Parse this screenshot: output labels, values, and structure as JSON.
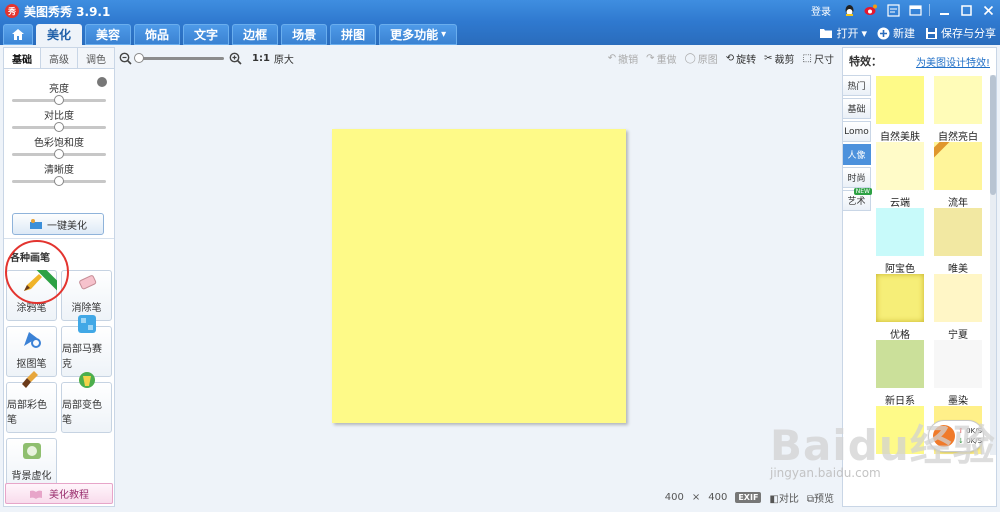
{
  "app": {
    "title": "美图秀秀 3.9.1",
    "logo_text": "秀"
  },
  "titlebar": {
    "login": "登录"
  },
  "nav": {
    "tabs": [
      {
        "label": "美化",
        "active": true
      },
      {
        "label": "美容"
      },
      {
        "label": "饰品"
      },
      {
        "label": "文字"
      },
      {
        "label": "边框"
      },
      {
        "label": "场景"
      },
      {
        "label": "拼图"
      },
      {
        "label": "更多功能"
      }
    ],
    "open": "打开",
    "new": "新建",
    "save_share": "保存与分享"
  },
  "left": {
    "subtabs": [
      "基础",
      "高级",
      "调色"
    ],
    "sliders": [
      {
        "label": "亮度",
        "value": 0.5
      },
      {
        "label": "对比度",
        "value": 0.5
      },
      {
        "label": "色彩饱和度",
        "value": 0.5
      },
      {
        "label": "清晰度",
        "value": 0.5
      }
    ],
    "one_key": "一键美化",
    "brushes_title": "各种画笔",
    "brushes": [
      {
        "label": "涂鸦笔"
      },
      {
        "label": "消除笔"
      },
      {
        "label": "抠图笔"
      },
      {
        "label": "局部马赛克"
      },
      {
        "label": "局部彩色笔"
      },
      {
        "label": "局部变色笔"
      },
      {
        "label": "背景虚化"
      }
    ],
    "tutorial": "美化教程"
  },
  "toolbar": {
    "ratio": "1:1",
    "original": "原大",
    "undo": "撤销",
    "redo": "重做",
    "orig_pic": "原图",
    "rotate": "旋转",
    "crop": "裁剪",
    "size": "尺寸"
  },
  "canvas": {
    "color": "#fefa88"
  },
  "status": {
    "width": "400",
    "times": "×",
    "height": "400",
    "exif": "EXIF",
    "compare": "对比",
    "preview": "预览"
  },
  "right": {
    "title": "特效：",
    "link": "为美图设计特效!",
    "categories": [
      {
        "label": "热门"
      },
      {
        "label": "基础"
      },
      {
        "label": "Lomo"
      },
      {
        "label": "人像",
        "active": true
      },
      {
        "label": "时尚"
      },
      {
        "label": "艺术",
        "badge": "NEW"
      }
    ],
    "effects": [
      {
        "label": "自然美肤",
        "color": "#fefa88"
      },
      {
        "label": "自然亮白",
        "color": "#fffcb8"
      },
      {
        "label": "云端",
        "color": "#fffbc8"
      },
      {
        "label": "流年",
        "color": "#fff59a"
      },
      {
        "label": "阿宝色",
        "color": "#c8fafa"
      },
      {
        "label": "唯美",
        "color": "#f2e8a2"
      },
      {
        "label": "优格",
        "color": "#f6ee78"
      },
      {
        "label": "宁夏",
        "color": "#fff6c6"
      },
      {
        "label": "新日系",
        "color": "#cbe09a"
      },
      {
        "label": "墨染",
        "color": "#f7f7f7"
      }
    ]
  },
  "speed": {
    "up": "0K/S",
    "down": "0K/S"
  },
  "watermark": {
    "main": "Baidu经验",
    "sub": "jingyan.baidu.com"
  }
}
